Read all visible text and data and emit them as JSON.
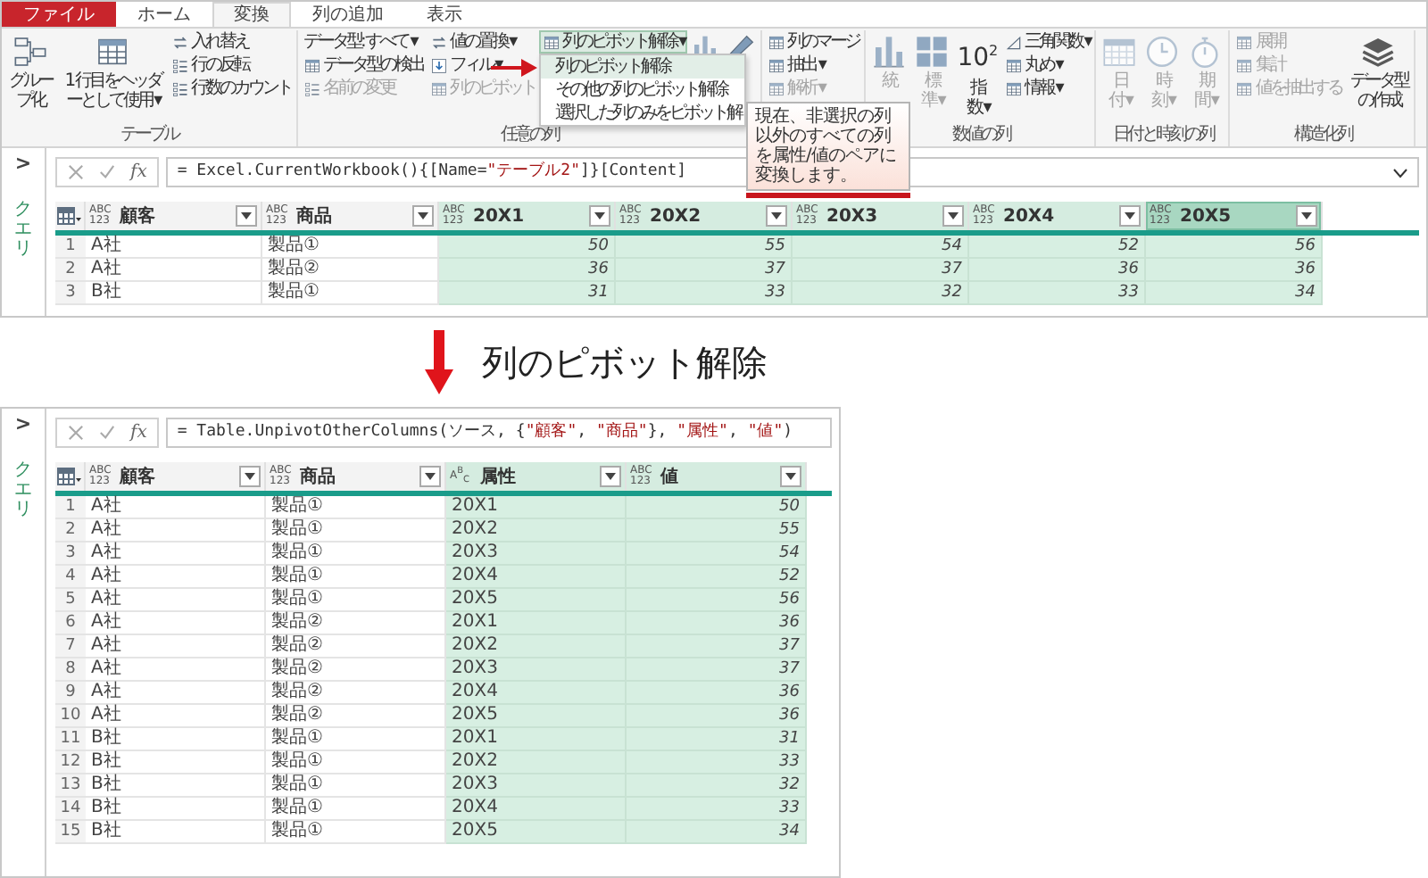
{
  "ribbon": {
    "tabs": [
      {
        "label": "ファイル",
        "kind": "file",
        "selected": false
      },
      {
        "label": "ホーム",
        "kind": "tab",
        "selected": false
      },
      {
        "label": "変換",
        "kind": "tab",
        "selected": true
      },
      {
        "label": "列の追加",
        "kind": "tab",
        "selected": false
      },
      {
        "label": "表示",
        "kind": "tab",
        "selected": false
      }
    ],
    "groups": [
      {
        "label": "テーブル",
        "columns": [
          [
            {
              "label": "グループ化",
              "kind": "large",
              "disabled": false,
              "pressed": false
            }
          ],
          [
            {
              "label": "1 行目をヘッダーとして使用 ▾",
              "kind": "large",
              "disabled": false,
              "pressed": false
            }
          ],
          [
            {
              "label": "入れ替え",
              "kind": "small",
              "disabled": false,
              "pressed": false
            },
            {
              "label": "行の反転",
              "kind": "small",
              "disabled": false,
              "pressed": false
            },
            {
              "label": "行数のカウント",
              "kind": "small",
              "disabled": false,
              "pressed": false
            }
          ]
        ]
      },
      {
        "label": "任意の列",
        "columns": [
          [
            {
              "label": "データ型: すべて ▾",
              "kind": "small",
              "disabled": false,
              "pressed": false
            },
            {
              "label": "データ型の検出",
              "kind": "small",
              "disabled": false,
              "pressed": false
            },
            {
              "label": "名前の変更",
              "kind": "small",
              "disabled": true,
              "pressed": false
            }
          ],
          [
            {
              "label": "値の置換 ▾",
              "kind": "small",
              "disabled": false,
              "pressed": false
            },
            {
              "label": "フィル ▾",
              "kind": "small",
              "disabled": false,
              "pressed": false
            },
            {
              "label": "列のピボット",
              "kind": "small",
              "disabled": true,
              "pressed": false
            }
          ],
          [
            {
              "label": "列のピボット解除 ▾",
              "kind": "small",
              "disabled": false,
              "pressed": true
            }
          ],
          [
            {
              "kind": "icon",
              "disabled": true,
              "pressed": false
            }
          ],
          [
            {
              "kind": "icon",
              "disabled": false,
              "pressed": false
            }
          ]
        ]
      },
      {
        "columns": [
          [
            {
              "label": "列のマージ",
              "kind": "small",
              "disabled": false,
              "pressed": false
            },
            {
              "label": "抽出 ▾",
              "kind": "small",
              "disabled": false,
              "pressed": false
            },
            {
              "label": "解析 ▾",
              "kind": "small",
              "disabled": true,
              "pressed": false
            }
          ]
        ]
      },
      {
        "label": "数値の列",
        "columns": [
          [
            {
              "label": "統",
              "kind": "tall",
              "disabled": true,
              "pressed": false
            }
          ],
          [
            {
              "label": "標準 ▾",
              "kind": "tall",
              "disabled": true,
              "pressed": false
            }
          ],
          [
            {
              "label": "指数 ▾",
              "kind": "tall",
              "icon_text": "10$^{2}$",
              "disabled": false,
              "pressed": false
            }
          ],
          [
            {
              "label": "三角関数 ▾",
              "kind": "small",
              "disabled": false,
              "pressed": false
            },
            {
              "label": "丸め ▾",
              "kind": "small",
              "disabled": false,
              "pressed": false
            },
            {
              "label": "情報 ▾",
              "kind": "small",
              "disabled": false,
              "pressed": false
            }
          ]
        ]
      },
      {
        "label": "日付と時刻の列",
        "columns": [
          [
            {
              "label": "日付 ▾",
              "kind": "tall",
              "disabled": true,
              "pressed": false
            }
          ],
          [
            {
              "label": "時刻 ▾",
              "kind": "tall",
              "disabled": true,
              "pressed": false
            }
          ],
          [
            {
              "label": "期間 ▾",
              "kind": "tall",
              "disabled": true,
              "pressed": false
            }
          ]
        ]
      },
      {
        "label": "構造化列",
        "columns": [
          [
            {
              "label": "展開",
              "kind": "small",
              "disabled": true,
              "pressed": false
            },
            {
              "label": "集計",
              "kind": "small",
              "disabled": true,
              "pressed": false
            },
            {
              "label": "値を抽出する",
              "kind": "small",
              "disabled": true,
              "pressed": false
            }
          ],
          [
            {
              "label": "データ型の作成",
              "kind": "large",
              "disabled": false,
              "pressed": false
            }
          ]
        ]
      }
    ],
    "menu": {
      "items": [
        {
          "label": "列のピボット解除",
          "selected": true
        },
        {
          "label": "その他の列のピボット解除",
          "selected": false
        },
        {
          "label": "選択した列のみをピボット解",
          "selected": false
        }
      ]
    },
    "tooltip": {
      "text": "現在、非選択の列以外のすべての列を属性/値のペアに変換します。"
    }
  },
  "before": {
    "pane": {
      "toggle": ">",
      "label": "クエリ"
    },
    "fx": "fx",
    "formula": [
      {
        "text": "= Excel.CurrentWorkbook(){[Name=",
        "kind": "code"
      },
      {
        "text": "\"テーブル2\"",
        "kind": "string"
      },
      {
        "text": "]}[Content]",
        "kind": "code"
      }
    ],
    "columns": [
      {
        "type": "ABC 123",
        "name": "顧客",
        "kind": "text",
        "selected": false,
        "focused": false
      },
      {
        "type": "ABC 123",
        "name": "商品",
        "kind": "text",
        "selected": false,
        "focused": false
      },
      {
        "type": "ABC 123",
        "name": "20X1",
        "kind": "number",
        "selected": true,
        "focused": false
      },
      {
        "type": "ABC 123",
        "name": "20X2",
        "kind": "number",
        "selected": true,
        "focused": false
      },
      {
        "type": "ABC 123",
        "name": "20X3",
        "kind": "number",
        "selected": true,
        "focused": false
      },
      {
        "type": "ABC 123",
        "name": "20X4",
        "kind": "number",
        "selected": true,
        "focused": false
      },
      {
        "type": "ABC 123",
        "name": "20X5",
        "kind": "number",
        "selected": true,
        "focused": true
      }
    ],
    "rows": [
      {
        "number": "1",
        "cells": [
          "A社",
          "製品①",
          "50",
          "55",
          "54",
          "52",
          "56"
        ]
      },
      {
        "number": "2",
        "cells": [
          "A社",
          "製品②",
          "36",
          "37",
          "37",
          "36",
          "36"
        ]
      },
      {
        "number": "3",
        "cells": [
          "B社",
          "製品①",
          "31",
          "33",
          "32",
          "33",
          "34"
        ]
      }
    ]
  },
  "caption": "列のピボット解除",
  "after": {
    "pane": {
      "toggle": ">",
      "label": "クエリ"
    },
    "fx": "fx",
    "formula": [
      {
        "text": "= Table.UnpivotOtherColumns(ソース, {",
        "kind": "code"
      },
      {
        "text": "\"顧客\"",
        "kind": "string"
      },
      {
        "text": ", ",
        "kind": "code"
      },
      {
        "text": "\"商品\"",
        "kind": "string"
      },
      {
        "text": "}, ",
        "kind": "code"
      },
      {
        "text": "\"属性\"",
        "kind": "string"
      },
      {
        "text": ", ",
        "kind": "code"
      },
      {
        "text": "\"値\"",
        "kind": "string"
      },
      {
        "text": ")",
        "kind": "code"
      }
    ],
    "columns": [
      {
        "type": "ABC 123",
        "name": "顧客",
        "kind": "text",
        "selected": false,
        "focused": false
      },
      {
        "type": "ABC 123",
        "name": "商品",
        "kind": "text",
        "selected": false,
        "focused": false
      },
      {
        "type": "A$^{B}$$_{C}$",
        "name": "属性",
        "kind": "text",
        "selected": true,
        "focused": false
      },
      {
        "type": "ABC 123",
        "name": "値",
        "kind": "number",
        "selected": true,
        "focused": false
      }
    ],
    "rows": [
      {
        "number": "1",
        "cells": [
          "A社",
          "製品①",
          "20X1",
          "50"
        ]
      },
      {
        "number": "2",
        "cells": [
          "A社",
          "製品①",
          "20X2",
          "55"
        ]
      },
      {
        "number": "3",
        "cells": [
          "A社",
          "製品①",
          "20X3",
          "54"
        ]
      },
      {
        "number": "4",
        "cells": [
          "A社",
          "製品①",
          "20X4",
          "52"
        ]
      },
      {
        "number": "5",
        "cells": [
          "A社",
          "製品①",
          "20X5",
          "56"
        ]
      },
      {
        "number": "6",
        "cells": [
          "A社",
          "製品②",
          "20X1",
          "36"
        ]
      },
      {
        "number": "7",
        "cells": [
          "A社",
          "製品②",
          "20X2",
          "37"
        ]
      },
      {
        "number": "8",
        "cells": [
          "A社",
          "製品②",
          "20X3",
          "37"
        ]
      },
      {
        "number": "9",
        "cells": [
          "A社",
          "製品②",
          "20X4",
          "36"
        ]
      },
      {
        "number": "10",
        "cells": [
          "A社",
          "製品②",
          "20X5",
          "36"
        ]
      },
      {
        "number": "11",
        "cells": [
          "B社",
          "製品①",
          "20X1",
          "31"
        ]
      },
      {
        "number": "12",
        "cells": [
          "B社",
          "製品①",
          "20X2",
          "33"
        ]
      },
      {
        "number": "13",
        "cells": [
          "B社",
          "製品①",
          "20X3",
          "32"
        ]
      },
      {
        "number": "14",
        "cells": [
          "B社",
          "製品①",
          "20X4",
          "33"
        ]
      },
      {
        "number": "15",
        "cells": [
          "B社",
          "製品①",
          "20X5",
          "34"
        ]
      }
    ]
  }
}
